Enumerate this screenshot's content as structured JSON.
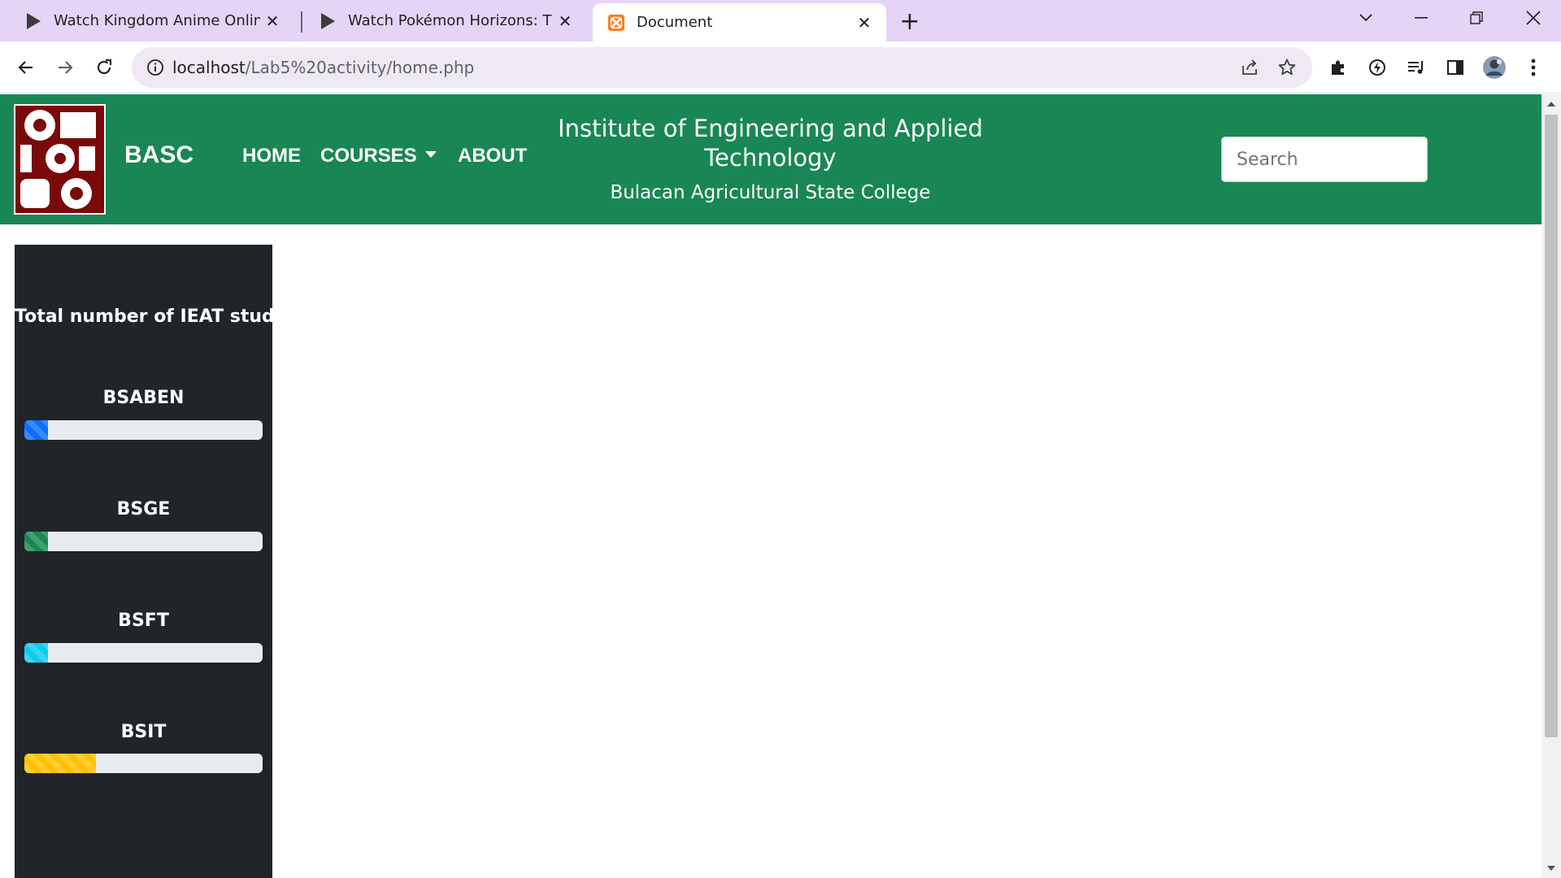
{
  "browser": {
    "tabs": [
      {
        "title": "Watch Kingdom Anime Online | "
      },
      {
        "title": "Watch Pokémon Horizons: The S"
      },
      {
        "title": "Document"
      }
    ],
    "url_host": "localhost",
    "url_path": "/Lab5%20activity/home.php"
  },
  "header": {
    "brand": "BASC",
    "nav": {
      "home": "HOME",
      "courses": "COURSES",
      "about": "ABOUT"
    },
    "institute_title": "Institute of Engineering and Applied Technology",
    "college_name": "Bulacan Agricultural State College",
    "search_placeholder": "Search"
  },
  "sidebar": {
    "title": "Total number of IEAT student",
    "courses": [
      {
        "label": "BSABEN",
        "progress_percent": 10,
        "color": "#0d6efd"
      },
      {
        "label": "BSGE",
        "progress_percent": 10,
        "color": "#198754"
      },
      {
        "label": "BSFT",
        "progress_percent": 10,
        "color": "#0dcaf0"
      },
      {
        "label": "BSIT",
        "progress_percent": 30,
        "color": "#ffc107"
      }
    ]
  },
  "colors": {
    "header_bg": "#198754",
    "sidebar_bg": "#212529",
    "logo_bg": "#7a0a0a",
    "tabstrip_bg": "#e5d4f5"
  }
}
